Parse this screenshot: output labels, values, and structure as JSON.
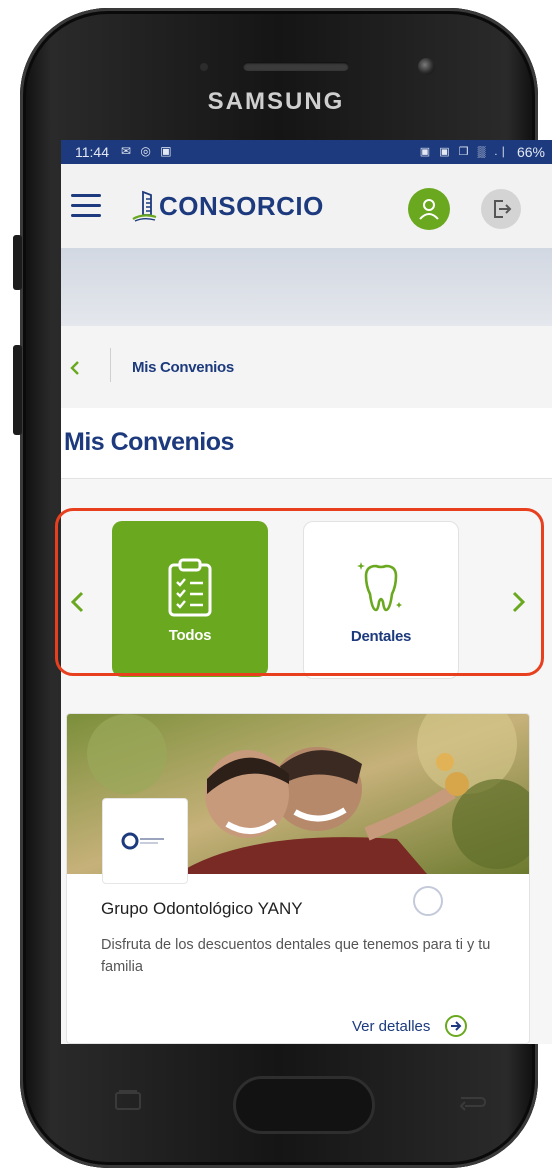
{
  "device": {
    "brand_text": "SAMSUNG"
  },
  "status_bar": {
    "time": "11:44",
    "left_icons": "✉ ◎ ▣",
    "right_icons": "▣ ▣ ❒ ▒ .∣",
    "battery": "66%"
  },
  "app_bar": {
    "logo_text": "CONSORCIO",
    "menu_icon": "hamburger-icon",
    "user_icon": "user-icon",
    "logout_icon": "logout-icon"
  },
  "breadcrumb": {
    "back_icon": "chevron-left-icon",
    "current": "Mis Convenios"
  },
  "page": {
    "title": "Mis Convenios"
  },
  "categories": {
    "prev_icon": "chevron-left-icon",
    "next_icon": "chevron-right-icon",
    "items": [
      {
        "label": "Todos",
        "icon": "clipboard-checklist-icon",
        "selected": true
      },
      {
        "label": "Dentales",
        "icon": "tooth-icon",
        "selected": false
      }
    ]
  },
  "agreement_card": {
    "title": "Grupo Odontológico YANY",
    "description": "Disfruta de los descuentos dentales que tenemos para ti y tu familia",
    "link_label": "Ver detalles",
    "link_icon": "arrow-right-circle-icon"
  },
  "colors": {
    "primary": "#1c3a7d",
    "accent": "#6aa81f",
    "highlight": "#e8401f"
  }
}
